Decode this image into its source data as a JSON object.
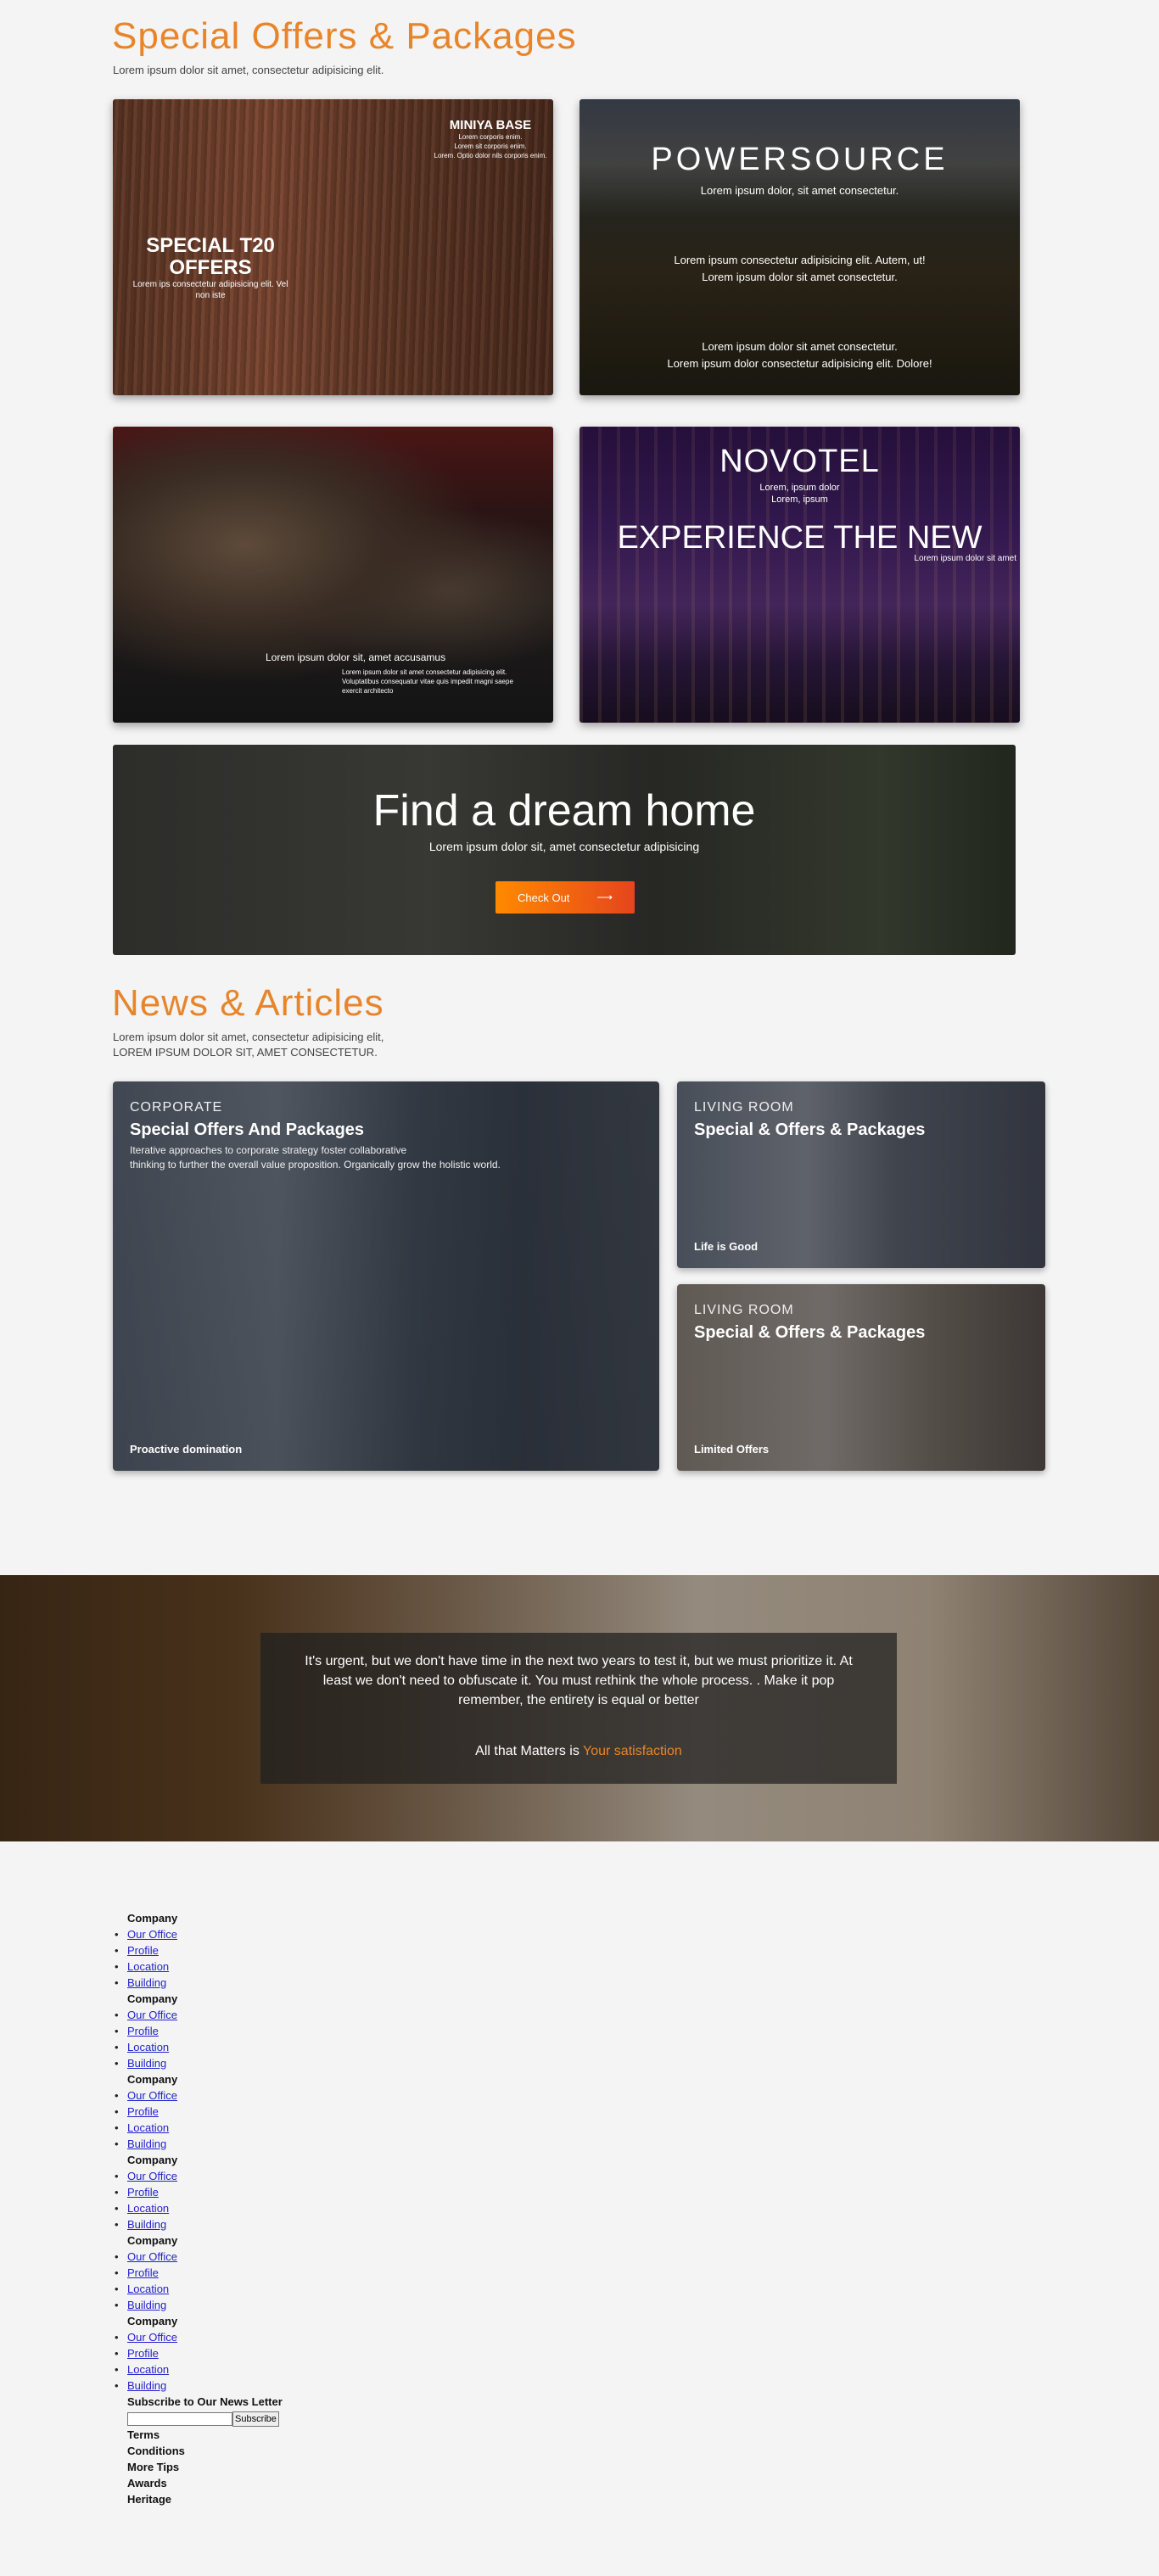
{
  "offers": {
    "title": "Special Offers & Packages",
    "subtitle": "Lorem ipsum dolor sit amet, consectetur adipisicing elit.",
    "card1": {
      "brand": "MINIYA BASE",
      "brand_lines": [
        "Lorem corporis enim.",
        "Lorem sit corporis enim.",
        "Lorem. Optio dolor nils corporis enim."
      ],
      "headline_1": "SPECIAL T20",
      "headline_2": "OFFERS",
      "desc_1": "Lorem ips consectetur adipisicing elit. Vel",
      "desc_2": "non iste"
    },
    "card2": {
      "brand": "POWERSOURCE",
      "tagline": "Lorem ipsum dolor, sit amet consectetur.",
      "mid_1": "Lorem ipsum consectetur adipisicing elit. Autem, ut!",
      "mid_2": "Lorem ipsum dolor sit amet consectetur.",
      "bot_1": "Lorem ipsum dolor sit amet consectetur.",
      "bot_2": "Lorem ipsum dolor consectetur adipisicing elit. Dolore!"
    },
    "card3": {
      "caption": "Lorem ipsum dolor sit, amet accusamus",
      "small_1": "Lorem ipsum dolor sit amet consectetur adipisicing elit.",
      "small_2": "Voluptatibus consequatur vitae quis impedit magni saepe",
      "small_3": "exercit architecto"
    },
    "card4": {
      "brand": "NOVOTEL",
      "sub_1": "Lorem, ipsum dolor",
      "sub_2": "Lorem, ipsum",
      "headline": "EXPERIENCE THE NEW",
      "small": "Lorem ipsum dolor sit amet"
    },
    "banner": {
      "title": "Find a dream home",
      "subtitle": "Lorem ipsum dolor sit, amet consectetur adipisicing",
      "button": "Check Out",
      "arrow": "⟶"
    }
  },
  "news": {
    "title": "News & Articles",
    "subtitle_1": "Lorem ipsum dolor sit amet, consectetur adipisicing elit,",
    "subtitle_2": "LOREM IPSUM DOLOR SIT, AMET CONSECTETUR.",
    "big": {
      "category": "CORPORATE",
      "heading": "Special Offers And Packages",
      "body_1": "Iterative approaches to corporate strategy foster collaborative",
      "body_2": "thinking to further the overall value proposition. Organically grow the holistic world.",
      "footer": "Proactive domination"
    },
    "small1": {
      "category": "LIVING ROOM",
      "heading": "Special & Offers & Packages",
      "footer": "Life is Good"
    },
    "small2": {
      "category": "LIVING ROOM",
      "heading": "Special & Offers & Packages",
      "footer": "Limited Offers"
    }
  },
  "quote": {
    "text": "It's urgent, but we don't have time in the next two years to test it, but we must prioritize it. At least we don't need to obfuscate it. You must rethink the whole process. . Make it pop remember, the entirety is equal or better",
    "tag_prefix": "All that Matters is",
    "tag_accent": "Your satisfaction"
  },
  "footer": {
    "groups": [
      {
        "heading": "Company",
        "links": [
          "Our Office",
          "Profile",
          "Location",
          "Building"
        ]
      },
      {
        "heading": "Company",
        "links": [
          "Our Office",
          "Profile",
          "Location",
          "Building"
        ]
      },
      {
        "heading": "Company",
        "links": [
          "Our Office",
          "Profile",
          "Location",
          "Building"
        ]
      },
      {
        "heading": "Company",
        "links": [
          "Our Office",
          "Profile",
          "Location",
          "Building"
        ]
      },
      {
        "heading": "Company",
        "links": [
          "Our Office",
          "Profile",
          "Location",
          "Building"
        ]
      },
      {
        "heading": "Company",
        "links": [
          "Our Office",
          "Profile",
          "Location",
          "Building"
        ]
      }
    ],
    "newsletter_title": "Subscribe to Our News Letter",
    "newsletter_placeholder": "",
    "subscribe_label": "Subscribe",
    "bottom_links": [
      "Terms",
      "Conditions",
      "More Tips",
      "Awards",
      "Heritage"
    ]
  },
  "colors": {
    "accent": "#e8852a",
    "button_start": "#ff8a00",
    "button_end": "#e5451c"
  }
}
